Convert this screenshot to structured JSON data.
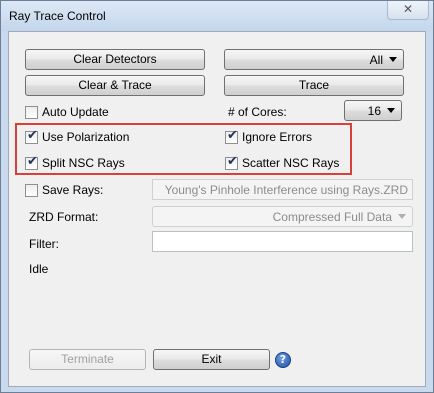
{
  "window": {
    "title": "Ray Trace Control",
    "close_glyph": "✕"
  },
  "buttons": {
    "clear_detectors": "Clear Detectors",
    "clear_and_trace": "Clear & Trace",
    "trace": "Trace",
    "terminate": "Terminate",
    "exit": "Exit"
  },
  "detector_select": {
    "value": "All"
  },
  "auto_update": {
    "label": "Auto Update",
    "checked": false
  },
  "cores": {
    "label": "# of Cores:",
    "value": "16"
  },
  "use_polarization": {
    "label": "Use Polarization",
    "checked": true
  },
  "ignore_errors": {
    "label": "Ignore Errors",
    "checked": true
  },
  "split_nsc_rays": {
    "label": "Split NSC Rays",
    "checked": true
  },
  "scatter_nsc_rays": {
    "label": "Scatter NSC Rays",
    "checked": true
  },
  "save_rays": {
    "label": "Save Rays:",
    "checked": false,
    "filename": "Young's Pinhole Interference using Rays.ZRD"
  },
  "zrd_format": {
    "label": "ZRD Format:",
    "value": "Compressed Full Data"
  },
  "filter": {
    "label": "Filter:",
    "value": ""
  },
  "status": {
    "text": "Idle"
  },
  "help": {
    "glyph": "?"
  },
  "check_glyph": "✔",
  "colors": {
    "highlight": "#d9403a",
    "title_bar": "#c9daee",
    "panel": "#f0f0f0"
  }
}
